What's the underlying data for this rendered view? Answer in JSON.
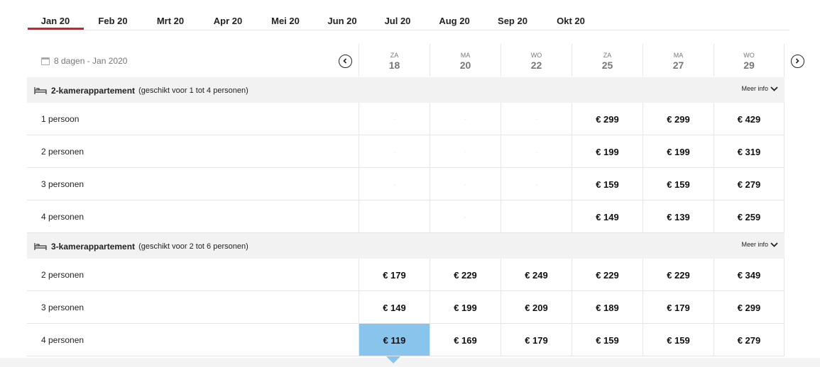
{
  "months": [
    "Jan 20",
    "Feb 20",
    "Mrt 20",
    "Apr 20",
    "Mei 20",
    "Jun 20",
    "Jul 20",
    "Aug 20",
    "Sep 20",
    "Okt 20"
  ],
  "active_month": "Jan 20",
  "header": {
    "range_label": "8 dagen - Jan 2020"
  },
  "dates": [
    {
      "dow": "ZA",
      "day": "18"
    },
    {
      "dow": "MA",
      "day": "20"
    },
    {
      "dow": "WO",
      "day": "22"
    },
    {
      "dow": "ZA",
      "day": "25"
    },
    {
      "dow": "MA",
      "day": "27"
    },
    {
      "dow": "WO",
      "day": "29"
    }
  ],
  "more_info_label": "Meer info",
  "rooms": [
    {
      "name": "2-kamerappartement",
      "subtitle": "(geschikt voor 1 tot 4 personen)",
      "rows": [
        {
          "label": "1 persoon",
          "prices": [
            "-",
            "-",
            "-",
            "€ 299",
            "€ 299",
            "€ 429"
          ]
        },
        {
          "label": "2 personen",
          "prices": [
            "-",
            "-",
            "-",
            "€ 199",
            "€ 199",
            "€ 319"
          ]
        },
        {
          "label": "3 personen",
          "prices": [
            "-",
            "-",
            "-",
            "€ 159",
            "€ 159",
            "€ 279"
          ]
        },
        {
          "label": "4 personen",
          "prices": [
            "",
            "-",
            "",
            "€ 149",
            "€ 139",
            "€ 259"
          ]
        }
      ]
    },
    {
      "name": "3-kamerappartement",
      "subtitle": "(geschikt voor 2 tot 6 personen)",
      "rows": [
        {
          "label": "2 personen",
          "prices": [
            "€ 179",
            "€ 229",
            "€ 249",
            "€ 229",
            "€ 229",
            "€ 349"
          ]
        },
        {
          "label": "3 personen",
          "prices": [
            "€ 149",
            "€ 199",
            "€ 209",
            "€ 189",
            "€ 179",
            "€ 299"
          ]
        },
        {
          "label": "4 personen",
          "prices": [
            "€ 119",
            "€ 169",
            "€ 179",
            "€ 159",
            "€ 159",
            "€ 279"
          ]
        }
      ]
    }
  ],
  "selected_cell": {
    "room": 1,
    "row": 2,
    "col": 0
  },
  "colors": {
    "accent": "#d0202a",
    "selected": "#89c4ec",
    "section_bg": "#f2f2f2"
  }
}
